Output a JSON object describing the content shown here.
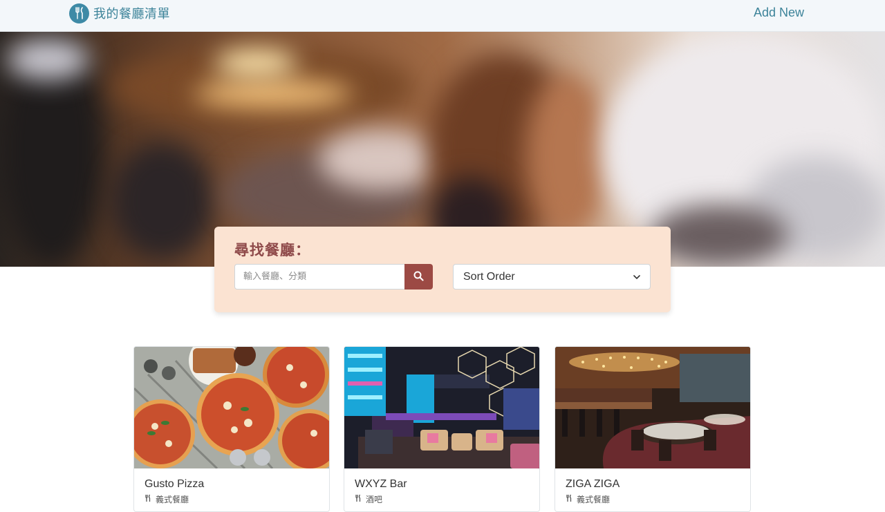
{
  "navbar": {
    "brand_icon": "utensils-icon",
    "brand_title": "我的餐廳清單",
    "add_new_label": "Add New"
  },
  "search": {
    "heading": "尋找餐廳：",
    "placeholder": "輸入餐廳、分類",
    "button_icon": "search-icon",
    "sort_selected": "Sort Order"
  },
  "restaurants": [
    {
      "name": "Gusto Pizza",
      "category": "義式餐廳",
      "category_icon": "utensils-icon"
    },
    {
      "name": "WXYZ Bar",
      "category": "酒吧",
      "category_icon": "utensils-icon"
    },
    {
      "name": "ZIGA ZIGA",
      "category": "義式餐廳",
      "category_icon": "utensils-icon"
    }
  ],
  "colors": {
    "brand": "#3c8399",
    "panel_bg": "#fbe3d2",
    "heading": "#8f4a4a",
    "search_button": "#9c4a44"
  }
}
